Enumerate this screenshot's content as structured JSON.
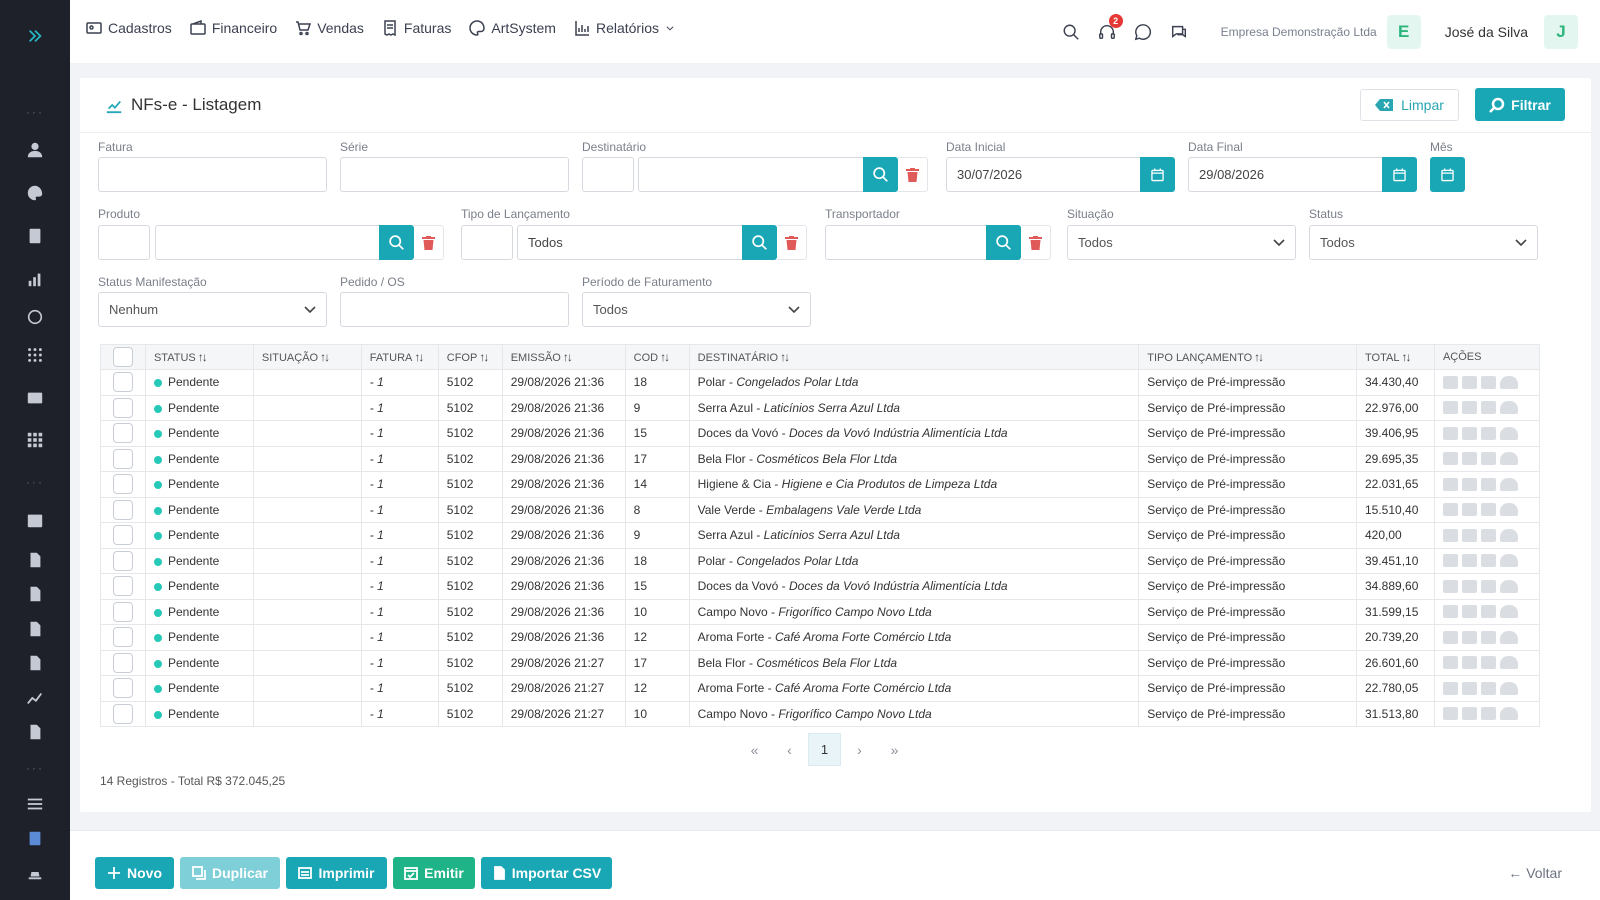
{
  "nav": {
    "items": [
      "Cadastros",
      "Financeiro",
      "Vendas",
      "Faturas",
      "ArtSystem",
      "Relatórios"
    ]
  },
  "topbar": {
    "notification_count": "2",
    "company": "Empresa Demonstração Ltda",
    "company_initial": "E",
    "user": "José da Silva",
    "user_initial": "J"
  },
  "page": {
    "title": "NFs-e - Listagem",
    "clear_label": "Limpar",
    "filter_label": "Filtrar"
  },
  "filters": {
    "fatura": "Fatura",
    "serie": "Série",
    "destinatario": "Destinatário",
    "data_inicial": "Data Inicial",
    "data_inicial_value": "30/07/2026",
    "data_final": "Data Final",
    "data_final_value": "29/08/2026",
    "mes": "Mês",
    "produto": "Produto",
    "tipo_lancamento": "Tipo de Lançamento",
    "tipo_lancamento_value": "Todos",
    "transportador": "Transportador",
    "situacao": "Situação",
    "situacao_value": "Todos",
    "status": "Status",
    "status_value": "Todos",
    "status_manifestacao": "Status Manifestação",
    "status_manifestacao_value": "Nenhum",
    "pedido_os": "Pedido / OS",
    "periodo_faturamento": "Período de Faturamento",
    "periodo_faturamento_value": "Todos"
  },
  "table": {
    "columns": [
      "STATUS",
      "SITUAÇÃO",
      "FATURA",
      "CFOP",
      "EMISSÃO",
      "COD",
      "DESTINATÁRIO",
      "TIPO LANÇAMENTO",
      "TOTAL",
      "AÇÕES"
    ],
    "rows": [
      {
        "status": "Pendente",
        "situacao": "",
        "fatura": "- 1",
        "cfop": "5102",
        "emissao": "29/08/2026 21:36",
        "cod": "18",
        "dest_name": "Polar",
        "dest_full": "Congelados Polar Ltda",
        "tipo": "Serviço de Pré-impressão",
        "total": "34.430,40"
      },
      {
        "status": "Pendente",
        "situacao": "",
        "fatura": "- 1",
        "cfop": "5102",
        "emissao": "29/08/2026 21:36",
        "cod": "9",
        "dest_name": "Serra Azul",
        "dest_full": "Laticínios Serra Azul Ltda",
        "tipo": "Serviço de Pré-impressão",
        "total": "22.976,00"
      },
      {
        "status": "Pendente",
        "situacao": "",
        "fatura": "- 1",
        "cfop": "5102",
        "emissao": "29/08/2026 21:36",
        "cod": "15",
        "dest_name": "Doces da Vovó",
        "dest_full": "Doces da Vovó Indústria Alimentícia Ltda",
        "tipo": "Serviço de Pré-impressão",
        "total": "39.406,95"
      },
      {
        "status": "Pendente",
        "situacao": "",
        "fatura": "- 1",
        "cfop": "5102",
        "emissao": "29/08/2026 21:36",
        "cod": "17",
        "dest_name": "Bela Flor",
        "dest_full": "Cosméticos Bela Flor Ltda",
        "tipo": "Serviço de Pré-impressão",
        "total": "29.695,35"
      },
      {
        "status": "Pendente",
        "situacao": "",
        "fatura": "- 1",
        "cfop": "5102",
        "emissao": "29/08/2026 21:36",
        "cod": "14",
        "dest_name": "Higiene & Cia",
        "dest_full": "Higiene e Cia Produtos de Limpeza Ltda",
        "tipo": "Serviço de Pré-impressão",
        "total": "22.031,65"
      },
      {
        "status": "Pendente",
        "situacao": "",
        "fatura": "- 1",
        "cfop": "5102",
        "emissao": "29/08/2026 21:36",
        "cod": "8",
        "dest_name": "Vale Verde",
        "dest_full": "Embalagens Vale Verde Ltda",
        "tipo": "Serviço de Pré-impressão",
        "total": "15.510,40"
      },
      {
        "status": "Pendente",
        "situacao": "",
        "fatura": "- 1",
        "cfop": "5102",
        "emissao": "29/08/2026 21:36",
        "cod": "9",
        "dest_name": "Serra Azul",
        "dest_full": "Laticínios Serra Azul Ltda",
        "tipo": "Serviço de Pré-impressão",
        "total": "420,00"
      },
      {
        "status": "Pendente",
        "situacao": "",
        "fatura": "- 1",
        "cfop": "5102",
        "emissao": "29/08/2026 21:36",
        "cod": "18",
        "dest_name": "Polar",
        "dest_full": "Congelados Polar Ltda",
        "tipo": "Serviço de Pré-impressão",
        "total": "39.451,10"
      },
      {
        "status": "Pendente",
        "situacao": "",
        "fatura": "- 1",
        "cfop": "5102",
        "emissao": "29/08/2026 21:36",
        "cod": "15",
        "dest_name": "Doces da Vovó",
        "dest_full": "Doces da Vovó Indústria Alimentícia Ltda",
        "tipo": "Serviço de Pré-impressão",
        "total": "34.889,60"
      },
      {
        "status": "Pendente",
        "situacao": "",
        "fatura": "- 1",
        "cfop": "5102",
        "emissao": "29/08/2026 21:36",
        "cod": "10",
        "dest_name": "Campo Novo",
        "dest_full": "Frigorífico Campo Novo Ltda",
        "tipo": "Serviço de Pré-impressão",
        "total": "31.599,15"
      },
      {
        "status": "Pendente",
        "situacao": "",
        "fatura": "- 1",
        "cfop": "5102",
        "emissao": "29/08/2026 21:36",
        "cod": "12",
        "dest_name": "Aroma Forte",
        "dest_full": "Café Aroma Forte Comércio Ltda",
        "tipo": "Serviço de Pré-impressão",
        "total": "20.739,20"
      },
      {
        "status": "Pendente",
        "situacao": "",
        "fatura": "- 1",
        "cfop": "5102",
        "emissao": "29/08/2026 21:27",
        "cod": "17",
        "dest_name": "Bela Flor",
        "dest_full": "Cosméticos Bela Flor Ltda",
        "tipo": "Serviço de Pré-impressão",
        "total": "26.601,60"
      },
      {
        "status": "Pendente",
        "situacao": "",
        "fatura": "- 1",
        "cfop": "5102",
        "emissao": "29/08/2026 21:27",
        "cod": "12",
        "dest_name": "Aroma Forte",
        "dest_full": "Café Aroma Forte Comércio Ltda",
        "tipo": "Serviço de Pré-impressão",
        "total": "22.780,05"
      },
      {
        "status": "Pendente",
        "situacao": "",
        "fatura": "- 1",
        "cfop": "5102",
        "emissao": "29/08/2026 21:27",
        "cod": "10",
        "dest_name": "Campo Novo",
        "dest_full": "Frigorífico Campo Novo Ltda",
        "tipo": "Serviço de Pré-impressão",
        "total": "31.513,80"
      }
    ]
  },
  "pagination": {
    "first": "«",
    "prev": "‹",
    "current": "1",
    "next": "›",
    "last": "»"
  },
  "summary": "14 Registros - Total R$ 372.045,25",
  "footer": {
    "novo": "Novo",
    "duplicar": "Duplicar",
    "imprimir": "Imprimir",
    "emitir": "Emitir",
    "importar_csv": "Importar CSV",
    "voltar": "Voltar"
  },
  "colors": {
    "accent": "#1aa7b5",
    "sidebar": "#1e2129",
    "emit_green": "#1fb487",
    "status_dot": "#26c9b7",
    "delete_red": "#e05a5a"
  }
}
